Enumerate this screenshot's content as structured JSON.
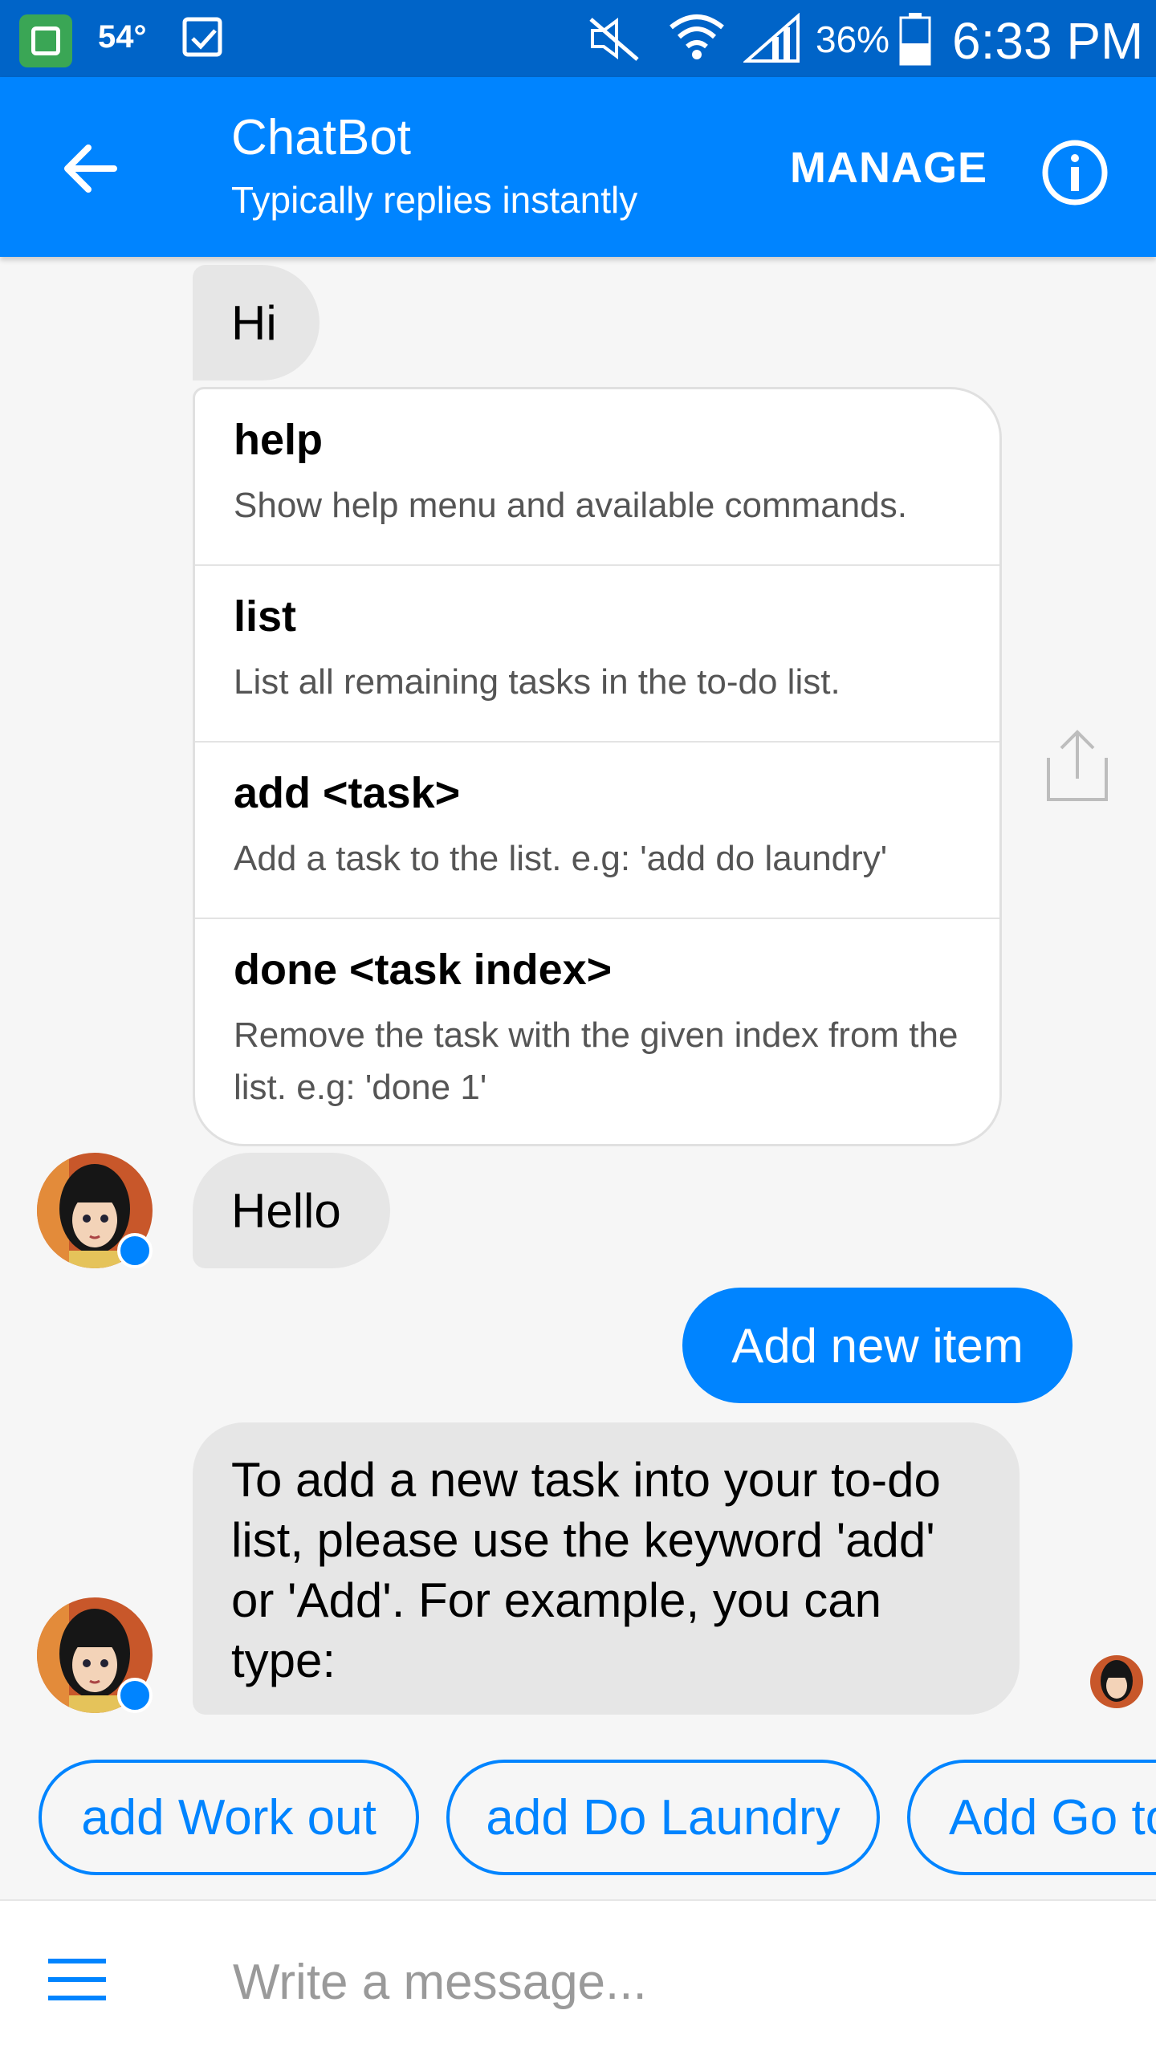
{
  "status_bar": {
    "temperature": "54°",
    "battery_percent": "36%",
    "time": "6:33 PM",
    "icons": [
      "app-icon",
      "checkbox-icon",
      "mute-icon",
      "wifi-icon",
      "signal-icon",
      "battery-icon"
    ]
  },
  "header": {
    "title": "ChatBot",
    "subtitle": "Typically replies instantly",
    "manage_label": "MANAGE",
    "colors": {
      "background": "#0084ff",
      "status_bar": "#0064c8"
    }
  },
  "messages": {
    "hi": "Hi",
    "commands": [
      {
        "name": "help",
        "description": "Show help menu and available commands."
      },
      {
        "name": "list",
        "description": "List all remaining tasks in the to-do list."
      },
      {
        "name": "add <task>",
        "description": "Add a task to the list. e.g: 'add do laundry'"
      },
      {
        "name": "done <task index>",
        "description": "Remove the task with the given index from the list. e.g: 'done 1'"
      }
    ],
    "hello": "Hello",
    "user_message": "Add new item",
    "bot_reply": "To add a new task into your to-do list, please use the keyword 'add' or 'Add'. For example, you can type:"
  },
  "quick_replies": [
    "add Work out",
    "add Do Laundry",
    "Add Go to"
  ],
  "composer": {
    "placeholder": "Write a message..."
  }
}
